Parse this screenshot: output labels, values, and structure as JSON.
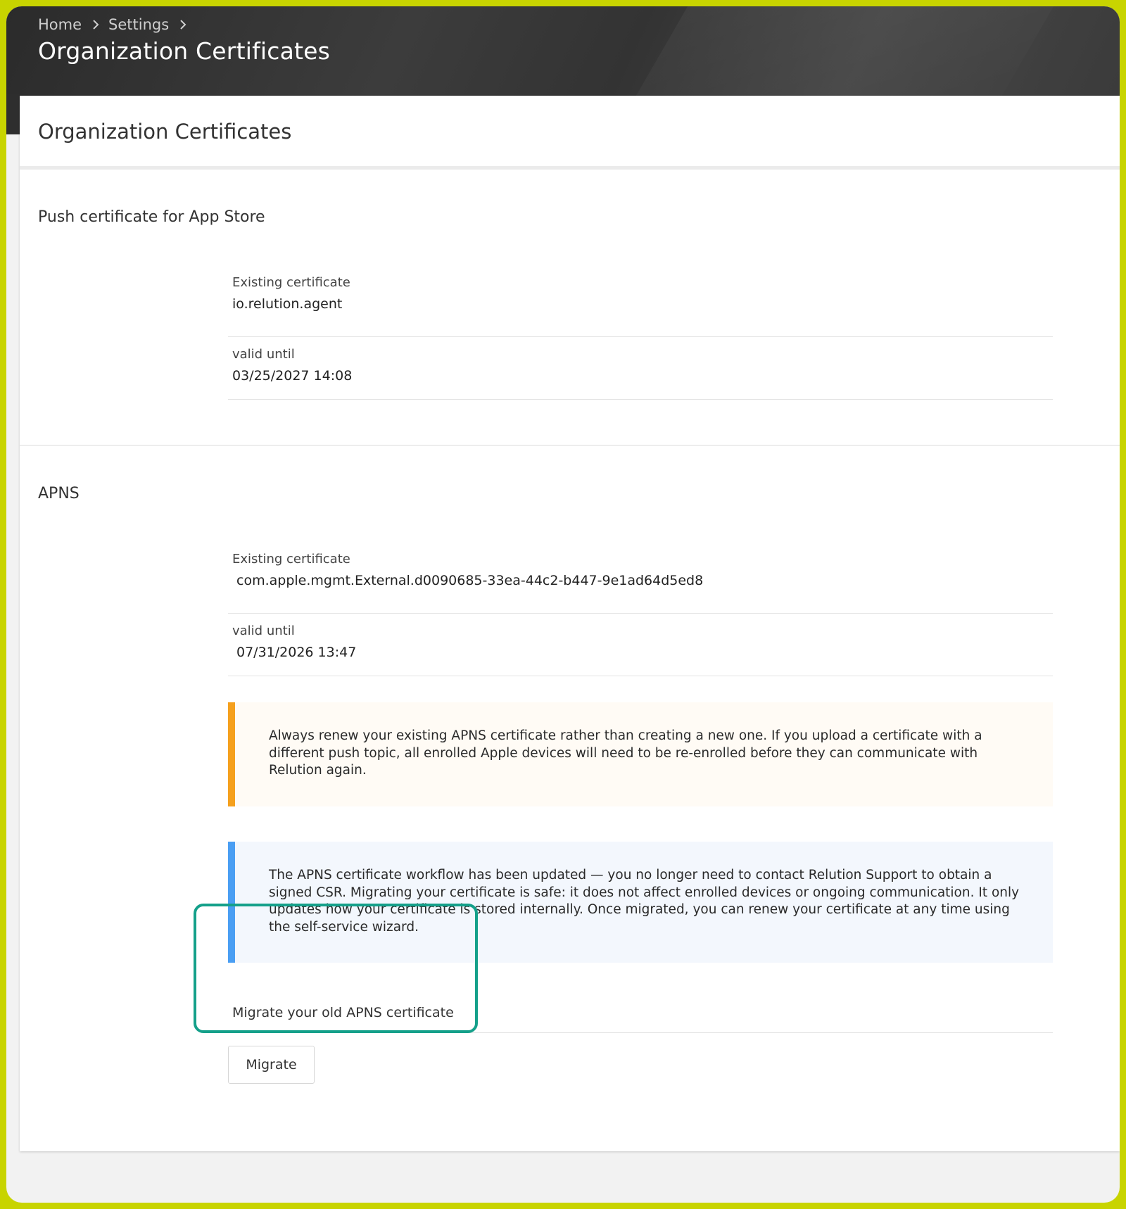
{
  "breadcrumb": {
    "items": [
      "Home",
      "Settings"
    ]
  },
  "header": {
    "title": "Organization Certificates"
  },
  "panel": {
    "title": "Organization Certificates"
  },
  "push_section": {
    "title": "Push certificate for App Store",
    "existing_label": "Existing certificate",
    "existing_value": "io.relution.agent",
    "valid_label": "valid until",
    "valid_value": "03/25/2027 14:08"
  },
  "apns_section": {
    "title": "APNS",
    "existing_label": "Existing certificate",
    "existing_value": "com.apple.mgmt.External.d0090685-33ea-44c2-b447-9e1ad64d5ed8",
    "valid_label": "valid until",
    "valid_value": "07/31/2026 13:47",
    "warning_text": "Always renew your existing APNS certificate rather than creating a new one. If you upload a certificate with a different push topic, all enrolled Apple devices will need to be re-enrolled before they can communicate with Relution again.",
    "info_text": "The APNS certificate workflow has been updated — you no longer need to contact Relution Support to obtain a signed CSR. Migrating your certificate is safe: it does not affect enrolled devices or ongoing communication. It only updates how your certificate is stored internally. Once migrated, you can renew your certificate at any time using the self-service wizard.",
    "migrate_label": "Migrate your old APNS certificate",
    "migrate_button": "Migrate"
  },
  "colors": {
    "frame_border": "#c8d400",
    "header_bg": "#333333",
    "warning_accent": "#f5a01d",
    "info_accent": "#4a9ef3",
    "highlight": "#14a08a"
  }
}
